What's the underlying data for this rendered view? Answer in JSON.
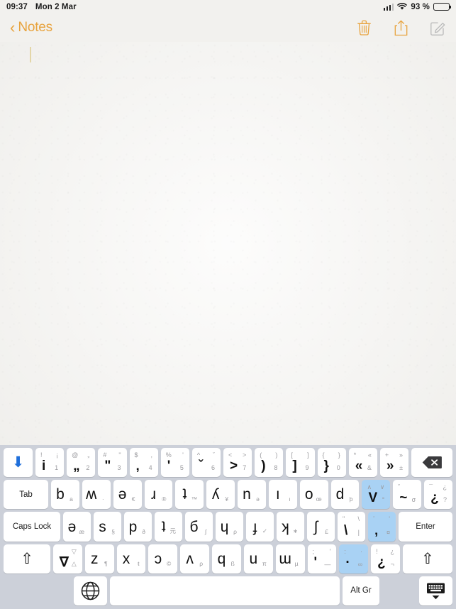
{
  "status_bar": {
    "time": "09:37",
    "date": "Mon 2 Mar",
    "battery_percent": "93 %",
    "signal_icon": "cellular-signal-icon",
    "wifi_icon": "wifi-icon",
    "battery_icon": "battery-icon"
  },
  "toolbar": {
    "back_chevron": "‹",
    "back_label": "Notes",
    "delete_icon": "trash-icon",
    "share_icon": "share-icon",
    "compose_icon": "compose-icon",
    "accent_color": "#E8A33D",
    "disabled_color": "#b9b9b9"
  },
  "note": {
    "content": "",
    "caret_color": "#E3D6A8"
  },
  "keyboard": {
    "background": "#ccd0d9",
    "key_color": "#ffffff",
    "highlight_color": "#a9d2f4",
    "row1": [
      {
        "name": "key-arrow-down",
        "type": "arrow",
        "main": "⬇"
      },
      {
        "name": "key-1",
        "tl": "!",
        "tr": "¡",
        "main": "i",
        "br": "1"
      },
      {
        "name": "key-2",
        "tl": "@",
        "tr": "„",
        "main": "„",
        "br": "2"
      },
      {
        "name": "key-3",
        "tl": "#",
        "tr": "\"",
        "main": "\"",
        "br": "3"
      },
      {
        "name": "key-4",
        "tl": "$",
        "tr": "‚",
        "main": "‚",
        "br": "4"
      },
      {
        "name": "key-5",
        "tl": "%",
        "tr": "'",
        "main": "'",
        "br": "5"
      },
      {
        "name": "key-6",
        "tl": "^",
        "tr": "ˇ",
        "main": "ˇ",
        "br": "6"
      },
      {
        "name": "key-7",
        "tl": "<",
        "tr": ">",
        "main": ">",
        "br": "7"
      },
      {
        "name": "key-8",
        "tl": "(",
        "tr": ")",
        "main": ")",
        "br": "8"
      },
      {
        "name": "key-9",
        "tl": "[",
        "tr": "]",
        "main": "]",
        "br": "9"
      },
      {
        "name": "key-0",
        "tl": "{",
        "tr": "}",
        "main": "}",
        "br": "0"
      },
      {
        "name": "key-guillemet-left",
        "tl": "*",
        "tr": "«",
        "main": "«",
        "br": "&"
      },
      {
        "name": "key-guillemet-right",
        "tl": "+",
        "tr": "»",
        "main": "»",
        "br": "±"
      },
      {
        "name": "key-backspace",
        "type": "backspace",
        "main": ""
      }
    ],
    "row2": [
      {
        "name": "key-tab",
        "type": "fn",
        "label": "Tab"
      },
      {
        "name": "key-b",
        "main": "b",
        "br": "a"
      },
      {
        "name": "key-w",
        "main": "ʍ",
        "br": "·"
      },
      {
        "name": "key-schwa",
        "main": "ǝ",
        "br": "€"
      },
      {
        "name": "key-turned-r",
        "main": "ɹ",
        "br": "®"
      },
      {
        "name": "key-t-bar",
        "main": "ʇ",
        "br": "™"
      },
      {
        "name": "key-turned-y",
        "main": "ʎ",
        "br": "¥"
      },
      {
        "name": "key-n",
        "main": "n",
        "br": "ə"
      },
      {
        "name": "key-i",
        "main": "ı",
        "br": "ı"
      },
      {
        "name": "key-o",
        "main": "o",
        "br": "œ"
      },
      {
        "name": "key-d",
        "main": "d",
        "br": "þ"
      },
      {
        "name": "key-v",
        "tl": "∧",
        "tr": "∨",
        "main": "V",
        "br": "°",
        "highlight": true
      },
      {
        "name": "key-tilde",
        "tl": "˘",
        "main": "~",
        "br": "σ"
      },
      {
        "name": "key-inverted-question",
        "tl": "¯",
        "tr": "¿",
        "main": "¿",
        "br": "?"
      }
    ],
    "row3": [
      {
        "name": "key-caps-lock",
        "type": "fn",
        "label": "Caps Lock"
      },
      {
        "name": "key-e",
        "main": "ǝ",
        "br": "æ"
      },
      {
        "name": "key-s",
        "main": "s",
        "br": "§"
      },
      {
        "name": "key-p",
        "main": "p",
        "br": "ð"
      },
      {
        "name": "key-t",
        "main": "ʇ",
        "br": "元"
      },
      {
        "name": "key-cyrillic-b",
        "main": "б",
        "br": "ʃ"
      },
      {
        "name": "key-cyrillic-ch",
        "main": "ɥ",
        "br": "ρ"
      },
      {
        "name": "key-turned-f",
        "main": "ɟ",
        "br": "✓"
      },
      {
        "name": "key-turned-k",
        "main": "ʞ",
        "br": "∗"
      },
      {
        "name": "key-integral",
        "main": "∫",
        "br": "£"
      },
      {
        "name": "key-backslash",
        "tl": "\"",
        "tr": "\\",
        "main": "\\",
        "br": "|"
      },
      {
        "name": "key-comma",
        "tl": "¨",
        "tr": "'",
        "main": "‚",
        "br": "¤",
        "highlight": true
      },
      {
        "name": "key-enter",
        "type": "fn",
        "label": "Enter"
      }
    ],
    "row4": [
      {
        "name": "key-shift-left",
        "type": "shift",
        "main": "⇧"
      },
      {
        "name": "key-nabla",
        "tr": "▽",
        "main": "∇",
        "br": "△"
      },
      {
        "name": "key-z",
        "main": "z",
        "br": "¶"
      },
      {
        "name": "key-x",
        "main": "x",
        "br": "ŧ"
      },
      {
        "name": "key-open-o",
        "main": "ɔ",
        "br": "©"
      },
      {
        "name": "key-turned-v",
        "main": "ʌ",
        "br": "ρ"
      },
      {
        "name": "key-q",
        "main": "q",
        "br": "ß"
      },
      {
        "name": "key-turned-u",
        "main": "u",
        "br": "π"
      },
      {
        "name": "key-cyrillic-sh",
        "main": "ɯ",
        "br": "µ"
      },
      {
        "name": "key-apostrophe",
        "tl": ";",
        "tr": "'",
        "main": "'",
        "br": "—"
      },
      {
        "name": "key-period",
        "tl": ":",
        "tr": "·",
        "main": "·",
        "br": "∞",
        "highlight": true
      },
      {
        "name": "key-inverted-question-2",
        "tl": "!",
        "tr": "¿",
        "main": "¿",
        "br": "¬"
      },
      {
        "name": "key-shift-right",
        "type": "shift",
        "main": "⇧"
      }
    ],
    "row5": [
      {
        "name": "key-globe",
        "type": "globe",
        "icon": "globe-icon"
      },
      {
        "name": "key-space",
        "type": "space",
        "label": ""
      },
      {
        "name": "key-alt-gr",
        "type": "fn",
        "label": "Alt Gr"
      },
      {
        "name": "key-hide-keyboard",
        "type": "hide",
        "icon": "hide-keyboard-icon"
      }
    ]
  }
}
